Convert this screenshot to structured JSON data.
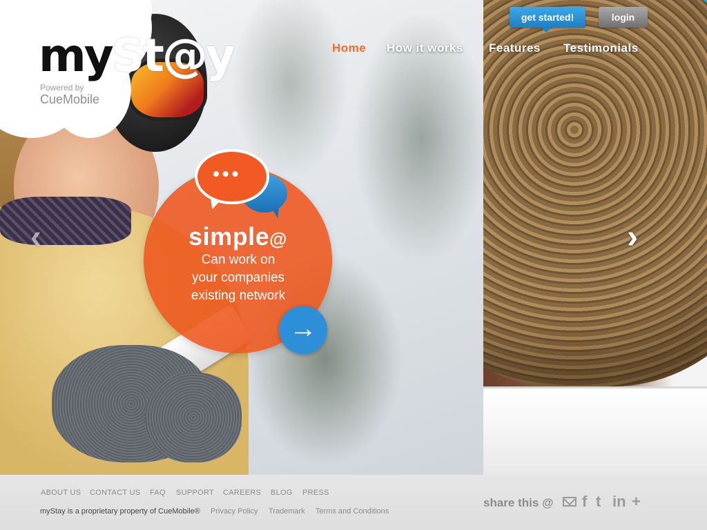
{
  "brand": {
    "logo_my": "my",
    "logo_stay": "St@y",
    "powered_by": "Powered by",
    "company": "CueMobile"
  },
  "header": {
    "get_started": "get started!",
    "login": "login",
    "nav": [
      "Home",
      "How it works",
      "Features",
      "Testimonials"
    ],
    "active_nav": "Home"
  },
  "hero": {
    "feature_title": "simple",
    "feature_title_suffix": "@",
    "feature_lines": [
      "Can work on",
      "your companies",
      "existing network"
    ],
    "arrow": "→",
    "prev": "‹",
    "next": "›",
    "accent_color": "#ee561c",
    "arrow_color": "#2c8fd8"
  },
  "footer": {
    "links": [
      "ABOUT US",
      "CONTACT US",
      "FAQ",
      "SUPPORT",
      "CAREERS",
      "BLOG",
      "PRESS"
    ],
    "copyright": "myStay is a proprietary property of CueMobile®",
    "legal": [
      "Privacy Policy",
      "Trademark",
      "Terms and Conditions"
    ],
    "share_label": "share this @",
    "share_icons": [
      "mail-icon",
      "facebook-icon",
      "twitter-icon",
      "linkedin-icon",
      "plus-icon"
    ]
  }
}
